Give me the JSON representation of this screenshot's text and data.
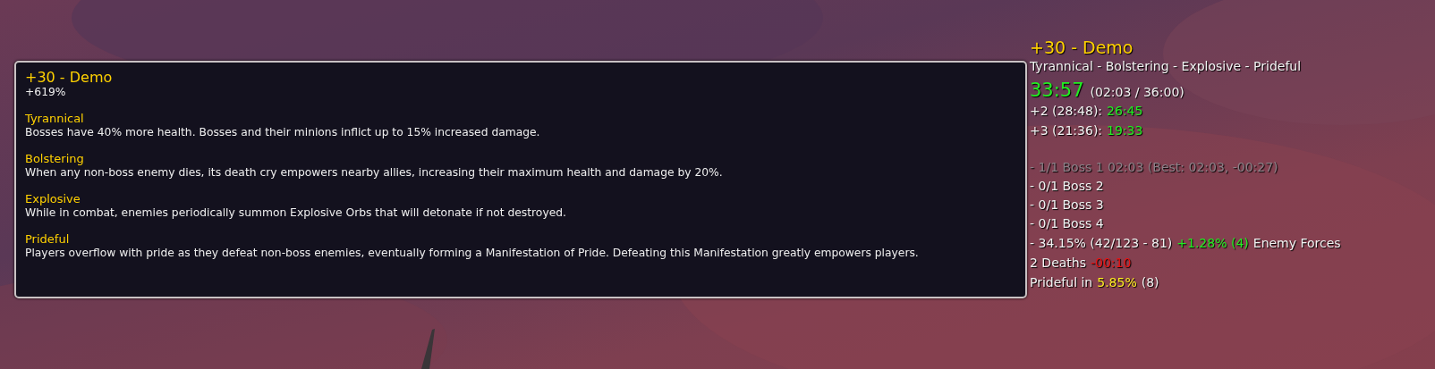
{
  "tooltip": {
    "title": "+30 - Demo",
    "bonus": "+619%",
    "affixes": [
      {
        "name": "Tyrannical",
        "description": "Bosses have 40% more health. Bosses and their minions inflict up to 15% increased damage."
      },
      {
        "name": "Bolstering",
        "description": "When any non-boss enemy dies, its death cry empowers nearby allies, increasing their maximum health and damage by 20%."
      },
      {
        "name": "Explosive",
        "description": "While in combat, enemies periodically summon Explosive Orbs that will detonate if not destroyed."
      },
      {
        "name": "Prideful",
        "description": "Players overflow with pride as they defeat non-boss enemies, eventually forming a Manifestation of Pride. Defeating this Manifestation greatly empowers players."
      }
    ]
  },
  "tracker": {
    "title": "+30 - Demo",
    "affixes": "Tyrannical - Bolstering - Explosive - Prideful",
    "timer": {
      "remaining": "33:57",
      "elapsed": "(02:03 / 36:00)"
    },
    "chests": [
      {
        "label": "+2 (28:48):",
        "time": "26:45"
      },
      {
        "label": "+3 (21:36):",
        "time": "19:33"
      }
    ],
    "objectives": [
      {
        "text": "- 1/1 Boss 1  02:03 (Best: 02:03, -00:27)",
        "completed": true
      },
      {
        "text": "- 0/1 Boss 2",
        "completed": false
      },
      {
        "text": "- 0/1 Boss 3",
        "completed": false
      },
      {
        "text": "- 0/1 Boss 4",
        "completed": false
      }
    ],
    "lines": [
      [
        {
          "text": "- 34.15%  (42/123 - 81)",
          "kind": "plain"
        },
        {
          "text": "+1.28% (4)",
          "kind": "good"
        },
        {
          "text": "Enemy Forces",
          "kind": "plain"
        }
      ],
      [
        {
          "text": "2 Deaths",
          "kind": "plain"
        },
        {
          "text": "-00:10",
          "kind": "bad"
        }
      ],
      [
        {
          "text": "Prideful in",
          "kind": "plain"
        },
        {
          "text": "5.85%",
          "kind": "warn"
        },
        {
          "text": "(8)",
          "kind": "plain"
        }
      ]
    ]
  }
}
